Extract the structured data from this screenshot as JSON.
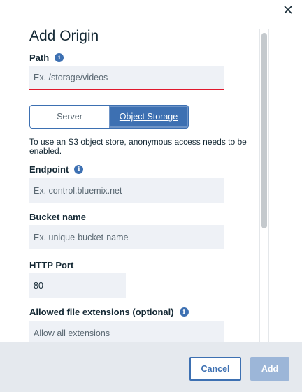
{
  "dialog": {
    "title": "Add Origin",
    "close_symbol": "✕",
    "info_symbol": "i"
  },
  "path": {
    "label": "Path",
    "placeholder": "Ex. /storage/videos",
    "value": ""
  },
  "origin_type": {
    "options": [
      "Server",
      "Object Storage"
    ],
    "selected": "Object Storage"
  },
  "note": "To use an S3 object store, anonymous access needs to be enabled.",
  "endpoint": {
    "label": "Endpoint",
    "placeholder": "Ex. control.bluemix.net"
  },
  "bucket": {
    "label": "Bucket name",
    "placeholder": "Ex. unique-bucket-name"
  },
  "http_port": {
    "label": "HTTP Port",
    "value": "80"
  },
  "extensions": {
    "label": "Allowed file extensions (optional)",
    "placeholder": "Allow all extensions"
  },
  "footer": {
    "cancel_label": "Cancel",
    "add_label": "Add"
  },
  "colors": {
    "accent": "#3d70b2",
    "error": "#e0182d",
    "field_bg": "#eef1f6",
    "footer_bg": "#e5e9ee"
  },
  "icons": [
    "close-icon",
    "info-icon"
  ]
}
